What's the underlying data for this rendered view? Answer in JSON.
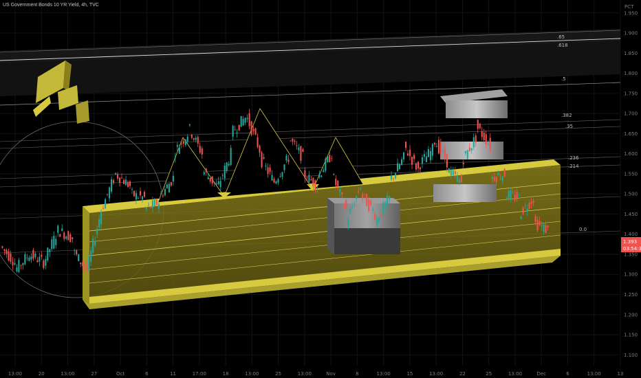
{
  "header": {
    "symbol_line": "US Government Bonds 10 YR Yield, 4h, TVC"
  },
  "price_axis": {
    "unit_label": "PCT",
    "ticks": [
      "1.950",
      "1.900",
      "1.850",
      "1.800",
      "1.750",
      "1.700",
      "1.650",
      "1.600",
      "1.550",
      "1.500",
      "1.450",
      "1.400",
      "1.350",
      "1.300",
      "1.250",
      "1.200",
      "1.150",
      "1.100"
    ],
    "last_price": "1.393",
    "countdown": "03:54:30"
  },
  "time_axis": {
    "ticks": [
      "13:00",
      "20",
      "13:00",
      "27",
      "Oct",
      "6",
      "11",
      "17:00",
      "18",
      "13:00",
      "25",
      "13:00",
      "Nov",
      "8",
      "13:00",
      "15",
      "13:00",
      "22",
      "25",
      "13:00",
      "Dec",
      "6",
      "13:00",
      "13"
    ]
  },
  "fib_labels": [
    ".65",
    ".618",
    ".5",
    ".382",
    ".35",
    ".236",
    ".214",
    "0.0"
  ],
  "colors": {
    "up": "#26a69a",
    "down": "#ef5350",
    "channel": "#d4c84a",
    "background": "#000000",
    "fib_line": "#555555"
  },
  "chart_data": {
    "type": "candlestick",
    "title": "US Government Bonds 10 YR Yield, 4h, TVC",
    "ylim": [
      1.08,
      1.965
    ],
    "y_axis": "right",
    "grid": true,
    "segments": [
      [
        1.37,
        1.33,
        1.36,
        1.31
      ],
      [
        1.31,
        1.35,
        1.33,
        1.37
      ],
      [
        1.35,
        1.33,
        1.34,
        1.37
      ],
      [
        1.33,
        1.41,
        1.4,
        1.44
      ],
      [
        1.41,
        1.39,
        1.38,
        1.36
      ],
      [
        1.36,
        1.31,
        1.33,
        1.3
      ],
      [
        1.31,
        1.46,
        1.45,
        1.5
      ],
      [
        1.46,
        1.55,
        1.53,
        1.55
      ],
      [
        1.55,
        1.52,
        1.53,
        1.5
      ],
      [
        1.5,
        1.49,
        1.48,
        1.46
      ],
      [
        1.46,
        1.48,
        1.47,
        1.49
      ],
      [
        1.49,
        1.54,
        1.56,
        1.6
      ],
      [
        1.6,
        1.65,
        1.63,
        1.67
      ],
      [
        1.67,
        1.6,
        1.61,
        1.56
      ],
      [
        1.56,
        1.52,
        1.53,
        1.51
      ],
      [
        1.51,
        1.6,
        1.62,
        1.65
      ],
      [
        1.65,
        1.69,
        1.68,
        1.7
      ],
      [
        1.7,
        1.61,
        1.63,
        1.59
      ],
      [
        1.59,
        1.53,
        1.55,
        1.53
      ],
      [
        1.53,
        1.59,
        1.61,
        1.64
      ],
      [
        1.64,
        1.59,
        1.58,
        1.55
      ],
      [
        1.55,
        1.52,
        1.53,
        1.54
      ],
      [
        1.54,
        1.6,
        1.58,
        1.55
      ],
      [
        1.55,
        1.46,
        1.47,
        1.43
      ],
      [
        1.43,
        1.52,
        1.51,
        1.5
      ],
      [
        1.5,
        1.45,
        1.44,
        1.43
      ],
      [
        1.43,
        1.49,
        1.48,
        1.53
      ],
      [
        1.53,
        1.59,
        1.6,
        1.62
      ],
      [
        1.62,
        1.56,
        1.55,
        1.57
      ],
      [
        1.57,
        1.61,
        1.63,
        1.64
      ],
      [
        1.64,
        1.58,
        1.58,
        1.56
      ],
      [
        1.56,
        1.53,
        1.55,
        1.58
      ],
      [
        1.58,
        1.64,
        1.65,
        1.67
      ],
      [
        1.67,
        1.62,
        1.58,
        1.54
      ],
      [
        1.54,
        1.55,
        1.54,
        1.5
      ],
      [
        1.5,
        1.49,
        1.46,
        1.45
      ],
      [
        1.45,
        1.49,
        1.48,
        1.43
      ],
      [
        1.43,
        1.41,
        1.4,
        1.39
      ]
    ]
  }
}
